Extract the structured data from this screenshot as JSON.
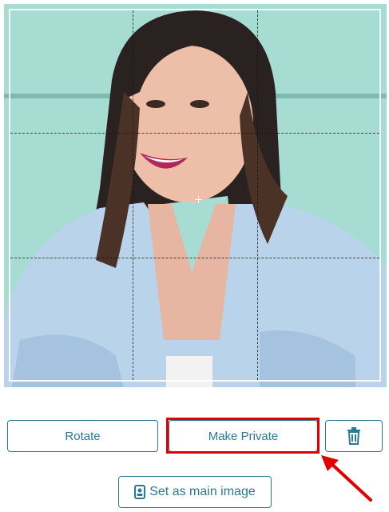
{
  "editor": {
    "photo_alt": "Profile photo of a smiling woman in a denim shirt in front of a mint green wall"
  },
  "actions": {
    "rotate_label": "Rotate",
    "make_private_label": "Make Private",
    "delete_icon": "trash-icon",
    "set_main_label": "Set as main image",
    "set_main_icon": "id-badge-icon"
  },
  "annotation": {
    "highlight_color": "#e00000",
    "arrow_color": "#e00000"
  },
  "colors": {
    "accent": "#2b7a93",
    "wall": "#a7dcd3",
    "shirt": "#b8d3ea"
  }
}
